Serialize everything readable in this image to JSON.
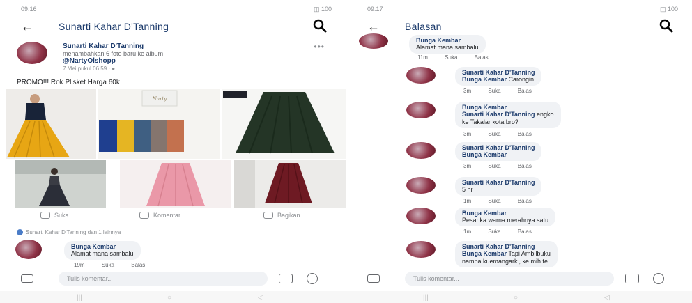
{
  "left": {
    "status": {
      "time": "09:16",
      "signal": "ᯤ ▮",
      "battery": "◫ 100"
    },
    "appbar": {
      "title": "Sunarti Kahar D'Tanning"
    },
    "post": {
      "author": "Sunarti Kahar D'Tanning",
      "action": "menambahkan 6 foto baru ke album",
      "page": "@NartyOlshopp",
      "time": "7 Mei pukul 06.59 · ",
      "text": "PROMO!!! Rok Plisket Harga 60k",
      "like": "Suka",
      "comment": "Komentar",
      "share": "Bagikan",
      "seen": "Sunarti Kahar D'Tanning dan 1 lainnya"
    },
    "comments": [
      {
        "name": "Bunga Kembar",
        "text": "Alamat mana sambalu",
        "time": "19m",
        "like": "Suka",
        "reply": "Balas"
      }
    ],
    "composer": {
      "placeholder": "Tulis komentar..."
    }
  },
  "right": {
    "status": {
      "time": "09:17",
      "signal": "ᯤ ▮",
      "battery": "◫ 100"
    },
    "appbar": {
      "title": "Balasan"
    },
    "comments": [
      {
        "name": "Bunga Kembar",
        "tag": "",
        "text": "Alamat mana sambalu",
        "time": "11m",
        "like": "Suka",
        "reply": "Balas"
      },
      {
        "name": "Sunarti Kahar D'Tanning",
        "tag": "Bunga Kembar",
        "text": " Carongin",
        "time": "3m",
        "like": "Suka",
        "reply": "Balas"
      },
      {
        "name": "Bunga Kembar",
        "tag": "Sunarti Kahar D'Tanning",
        "text": " engko",
        "text2": "ke Takalar kota bro?",
        "time": "3m",
        "like": "Suka",
        "reply": "Balas"
      },
      {
        "name": "Sunarti Kahar D'Tanning",
        "tag": "Bunga Kembar",
        "text": "",
        "time": "3m",
        "like": "Suka",
        "reply": "Balas"
      },
      {
        "name": "Sunarti Kahar D'Tanning",
        "tag": "",
        "text": "5 hr",
        "time": "1m",
        "like": "Suka",
        "reply": "Balas"
      },
      {
        "name": "Bunga Kembar",
        "tag": "",
        "text": "Pesanka warna merahnya satu",
        "time": "1m",
        "like": "Suka",
        "reply": "Balas"
      },
      {
        "name": "Sunarti Kahar D'Tanning",
        "tag": "Bunga Kembar",
        "text": " Tapi Ambilbuku",
        "text2": "nampa kuemangarki, ke mih te",
        "time": "",
        "like": "",
        "reply": ""
      }
    ],
    "composer": {
      "placeholder": "Tulis komentar..."
    }
  },
  "nav": {
    "menu": "|||",
    "home": "○",
    "back": "◁"
  },
  "colors": {
    "name": "#1b3a6b",
    "bubble": "#f0f2f5",
    "avatar": "#8f3347",
    "accent": "#4a7cc7"
  },
  "icons": [
    "back-arrow-icon",
    "search-icon",
    "like-icon",
    "comment-icon",
    "share-icon",
    "camera-icon",
    "gif-icon",
    "emoji-icon"
  ]
}
